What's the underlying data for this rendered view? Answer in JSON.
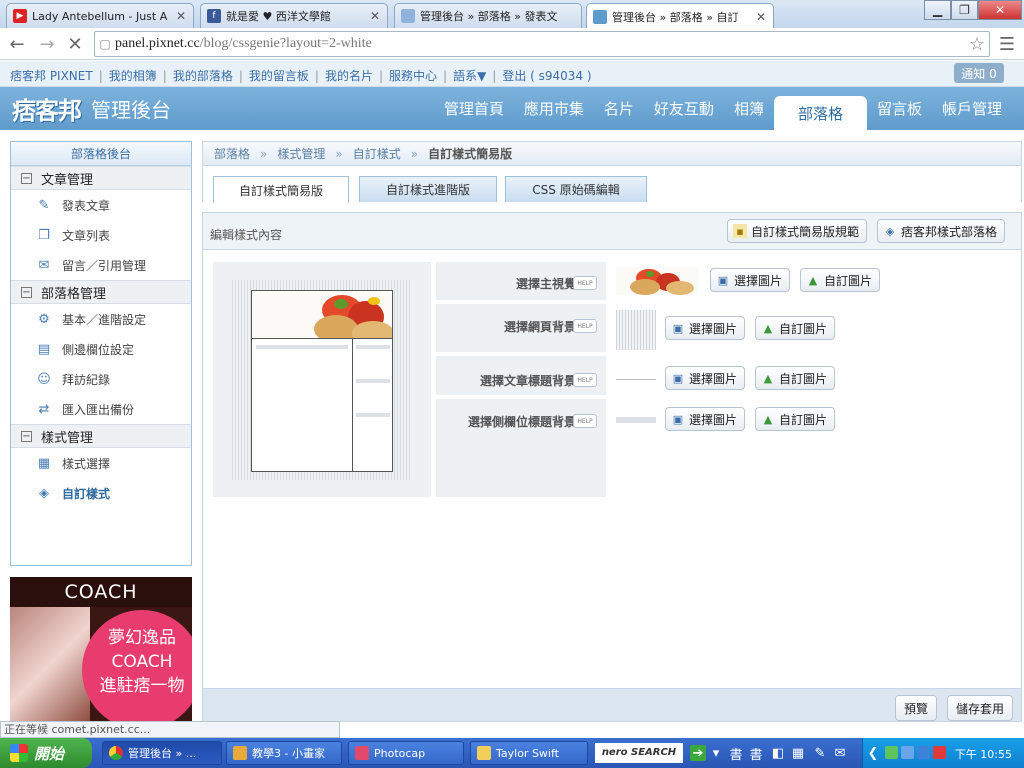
{
  "browser": {
    "tabs": [
      {
        "title": "Lady Antebellum - Just A Kis",
        "icon": "youtube-icon"
      },
      {
        "title": "就是愛 ♥ 西洋文學館",
        "icon": "facebook-icon"
      },
      {
        "title": "管理後台 » 部落格 » 發表文",
        "icon": "page-icon"
      },
      {
        "title": "管理後台 » 部落格 » 自訂",
        "icon": "page-icon"
      }
    ],
    "url_host": "panel.pixnet.cc",
    "url_path": "/blog/cssgenie?layout=2-white"
  },
  "linkbar": {
    "items": [
      "痞客邦 PIXNET",
      "我的相簿",
      "我的部落格",
      "我的留言板",
      "我的名片",
      "服務中心",
      "語系▼",
      "登出 ( s94034 )"
    ],
    "notification": "通知 0"
  },
  "header": {
    "brand": "痞客邦",
    "subtitle": "管理後台",
    "nav": [
      "管理首頁",
      "應用市集",
      "名片",
      "好友互動",
      "相簿",
      "部落格",
      "留言板",
      "帳戶管理"
    ],
    "active_nav": "部落格"
  },
  "sidebar": {
    "title": "部落格後台",
    "groups": [
      {
        "label": "文章管理",
        "items": [
          {
            "label": "發表文章",
            "icon": "pencil-icon"
          },
          {
            "label": "文章列表",
            "icon": "documents-icon"
          },
          {
            "label": "留言／引用管理",
            "icon": "speech-bubble-icon"
          }
        ]
      },
      {
        "label": "部落格管理",
        "items": [
          {
            "label": "基本／進階設定",
            "icon": "gear-icon"
          },
          {
            "label": "側邊欄位設定",
            "icon": "window-icon"
          },
          {
            "label": "拜訪紀錄",
            "icon": "users-icon"
          },
          {
            "label": "匯入匯出備份",
            "icon": "import-export-icon"
          }
        ]
      },
      {
        "label": "樣式管理",
        "items": [
          {
            "label": "樣式選擇",
            "icon": "grid-icon"
          },
          {
            "label": "自訂樣式",
            "icon": "custom-style-icon"
          }
        ]
      }
    ],
    "collapse_symbol": "⊟"
  },
  "ad": {
    "brand": "COACH",
    "line1": "夢幻逸品",
    "line2": "COACH",
    "line3": "進駐痞一物"
  },
  "breadcrumb": [
    "部落格",
    "樣式管理",
    "自訂樣式",
    "自訂樣式簡易版"
  ],
  "breadcrumb_sep": "»",
  "subtabs": [
    "自訂樣式簡易版",
    "自訂樣式進階版",
    "CSS 原始碼編輯"
  ],
  "edit": {
    "label": "編輯樣式內容",
    "spec_button": "自訂樣式簡易版規範",
    "pixnet_style_button": "痞客邦樣式部落格"
  },
  "options": [
    {
      "label": "選擇主視覺",
      "help": "HELP",
      "select": "選擇圖片",
      "custom": "自訂圖片"
    },
    {
      "label": "選擇網頁背景",
      "help": "HELP",
      "select": "選擇圖片",
      "custom": "自訂圖片"
    },
    {
      "label": "選擇文章標題背景",
      "help": "HELP",
      "select": "選擇圖片",
      "custom": "自訂圖片"
    },
    {
      "label": "選擇側欄位標題背景",
      "help": "HELP",
      "select": "選擇圖片",
      "custom": "自訂圖片"
    }
  ],
  "footer_buttons": {
    "preview": "預覽",
    "save": "儲存套用"
  },
  "status": "正在等候 comet.pixnet.cc...",
  "taskbar": {
    "start": "開始",
    "tasks": [
      "管理後台 » ...",
      "教學3 - 小畫家",
      "Photocap",
      "Taylor Swift"
    ],
    "nero": "nero SEARCH",
    "time": "下午 10:55"
  }
}
